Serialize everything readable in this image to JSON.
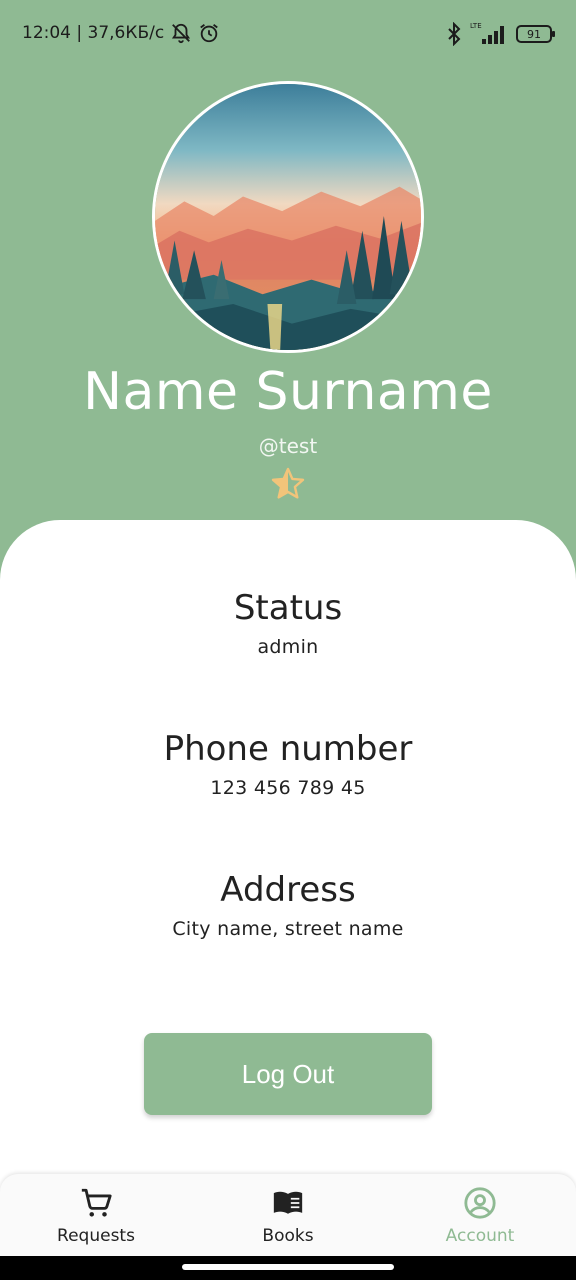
{
  "status_bar": {
    "time_info": "12:04 | 37,6КБ/с",
    "network_type": "LTE",
    "battery_level": "91"
  },
  "profile": {
    "name": "Name Surname",
    "handle": "@test",
    "rating_icon": "half-star-icon"
  },
  "info": [
    {
      "title": "Status",
      "value": "admin"
    },
    {
      "title": "Phone number",
      "value": "123 456 789 45"
    },
    {
      "title": "Address",
      "value": "City name, street name"
    }
  ],
  "actions": {
    "logout_label": "Log Out"
  },
  "nav": [
    {
      "label": "Requests",
      "icon": "cart-icon"
    },
    {
      "label": "Books",
      "icon": "book-icon"
    },
    {
      "label": "Account",
      "icon": "account-circle-icon",
      "active": true
    }
  ],
  "colors": {
    "accent": "#8fba93",
    "star": "#f2c47a"
  }
}
